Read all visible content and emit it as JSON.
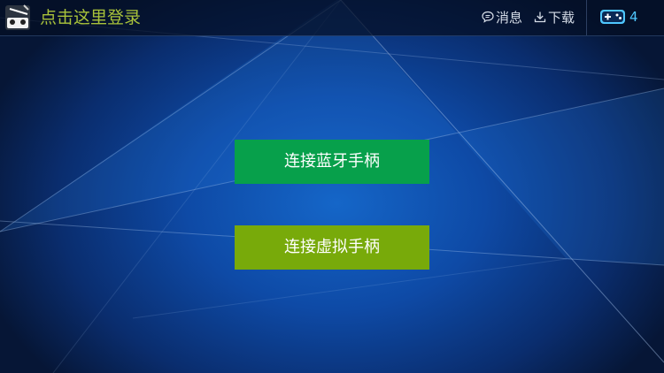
{
  "header": {
    "login_label": "点击这里登录",
    "messages_label": "消息",
    "download_label": "下载",
    "gamepad_count": "4"
  },
  "actions": {
    "bluetooth_label": "连接蓝牙手柄",
    "virtual_label": "连接虚拟手柄"
  },
  "icons": {
    "avatar": "robot-avatar-icon",
    "messages": "chat-bubble-icon",
    "download": "download-icon",
    "gamepad": "gamepad-icon"
  },
  "colors": {
    "login_text": "#a9c23a",
    "bluetooth_button": "#07a04b",
    "virtual_button": "#78aa0a",
    "gamepad_accent": "#4fc7ff"
  }
}
